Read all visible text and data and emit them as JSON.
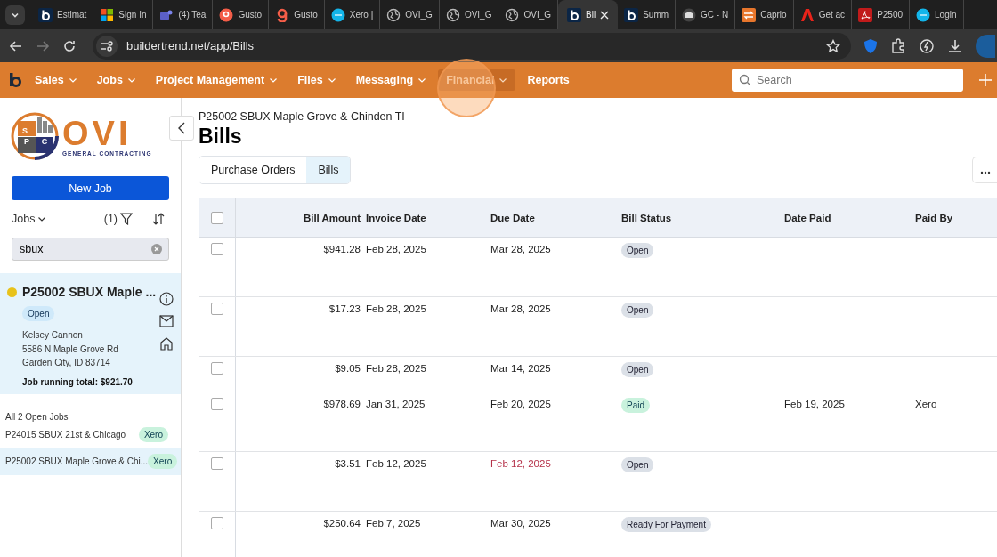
{
  "browser": {
    "tabs": [
      {
        "kind": "bt",
        "title": "Estimat",
        "selected": false
      },
      {
        "kind": "ms",
        "title": "Sign In",
        "selected": false
      },
      {
        "kind": "teams",
        "title": "(4) Tea",
        "selected": false
      },
      {
        "kind": "gustoround",
        "title": "Gusto",
        "selected": false
      },
      {
        "kind": "gusto",
        "title": "Gusto",
        "selected": false
      },
      {
        "kind": "xero",
        "title": "Xero |",
        "selected": false
      },
      {
        "kind": "globe",
        "title": "OVI_G",
        "selected": false
      },
      {
        "kind": "globe",
        "title": "OVI_G",
        "selected": false
      },
      {
        "kind": "globe",
        "title": "OVI_G",
        "selected": false
      },
      {
        "kind": "bt",
        "title": "Bil",
        "selected": true
      },
      {
        "kind": "bt",
        "title": "Summ",
        "selected": false
      },
      {
        "kind": "gc",
        "title": "GC - N",
        "selected": false
      },
      {
        "kind": "caprio",
        "title": "Caprio",
        "selected": false
      },
      {
        "kind": "adobe",
        "title": "Get ac",
        "selected": false
      },
      {
        "kind": "pdf",
        "title": "P2500",
        "selected": false
      },
      {
        "kind": "xero",
        "title": "Login",
        "selected": false
      }
    ],
    "url": "buildertrend.net/app/Bills"
  },
  "nav": {
    "items": [
      {
        "label": "Sales",
        "menu": true,
        "selected": false
      },
      {
        "label": "Jobs",
        "menu": true,
        "selected": false
      },
      {
        "label": "Project Management",
        "menu": true,
        "selected": false
      },
      {
        "label": "Files",
        "menu": true,
        "selected": false
      },
      {
        "label": "Messaging",
        "menu": true,
        "selected": false
      },
      {
        "label": "Financial",
        "menu": true,
        "selected": true
      },
      {
        "label": "Reports",
        "menu": false,
        "selected": false
      }
    ],
    "search": {
      "placeholder": "Search"
    }
  },
  "sidebar": {
    "logo": {
      "letters": [
        "S",
        "P",
        "C"
      ],
      "word": "OVI",
      "tagline": "GENERAL CONTRACTING"
    },
    "new_job": "New Job",
    "jobs_label": "Jobs",
    "filter_count": "(1)",
    "search": {
      "value": "sbux"
    },
    "current_job": {
      "title": "P25002 SBUX Maple ...",
      "color": "#e8c21a",
      "status": "Open",
      "contact": "Kelsey Cannon",
      "address": "5586 N Maple Grove Rd",
      "city": "Garden City, ID 83714",
      "total": "Job running total: $921.70"
    },
    "group_label": "All 2 Open Jobs",
    "jobs": [
      {
        "name": "P24015 SBUX 21st & Chicago",
        "tag": "Xero",
        "selected": false
      },
      {
        "name": "P25002 SBUX Maple Grove & Chi...",
        "tag": "Xero",
        "selected": true
      }
    ]
  },
  "page": {
    "job_title": "P25002 SBUX Maple Grove & Chinden TI",
    "title": "Bills",
    "tabs": [
      {
        "label": "Purchase Orders",
        "selected": false
      },
      {
        "label": "Bills",
        "selected": true
      }
    ],
    "table": {
      "columns": [
        "Bill Amount",
        "Invoice Date",
        "Due Date",
        "Bill Status",
        "Date Paid",
        "Paid By"
      ],
      "select_all_checked": false,
      "rows": [
        {
          "checked": false,
          "amount": "$941.28",
          "invoice_date": "Feb 28, 2025",
          "due_date": "Mar 28, 2025",
          "overdue": false,
          "status": "Open",
          "kind": "open"
        },
        {
          "checked": false,
          "amount": "$17.23",
          "invoice_date": "Feb 28, 2025",
          "due_date": "Mar 28, 2025",
          "overdue": false,
          "status": "Open",
          "kind": "open"
        },
        {
          "checked": false,
          "amount": "$9.05",
          "invoice_date": "Feb 28, 2025",
          "due_date": "Mar 14, 2025",
          "overdue": false,
          "status": "Open",
          "kind": "open"
        },
        {
          "checked": false,
          "amount": "$978.69",
          "invoice_date": "Jan 31, 2025",
          "due_date": "Feb 20, 2025",
          "overdue": false,
          "status": "Paid",
          "kind": "paid",
          "date_paid": "Feb 19, 2025",
          "paid_by": "Xero"
        },
        {
          "checked": false,
          "amount": "$3.51",
          "invoice_date": "Feb 12, 2025",
          "due_date": "Feb 12, 2025",
          "overdue": true,
          "status": "Open",
          "kind": "open"
        },
        {
          "checked": false,
          "amount": "$250.64",
          "invoice_date": "Feb 7, 2025",
          "due_date": "Mar 30, 2025",
          "overdue": false,
          "status": "Ready For Payment",
          "kind": "ready"
        }
      ]
    }
  }
}
